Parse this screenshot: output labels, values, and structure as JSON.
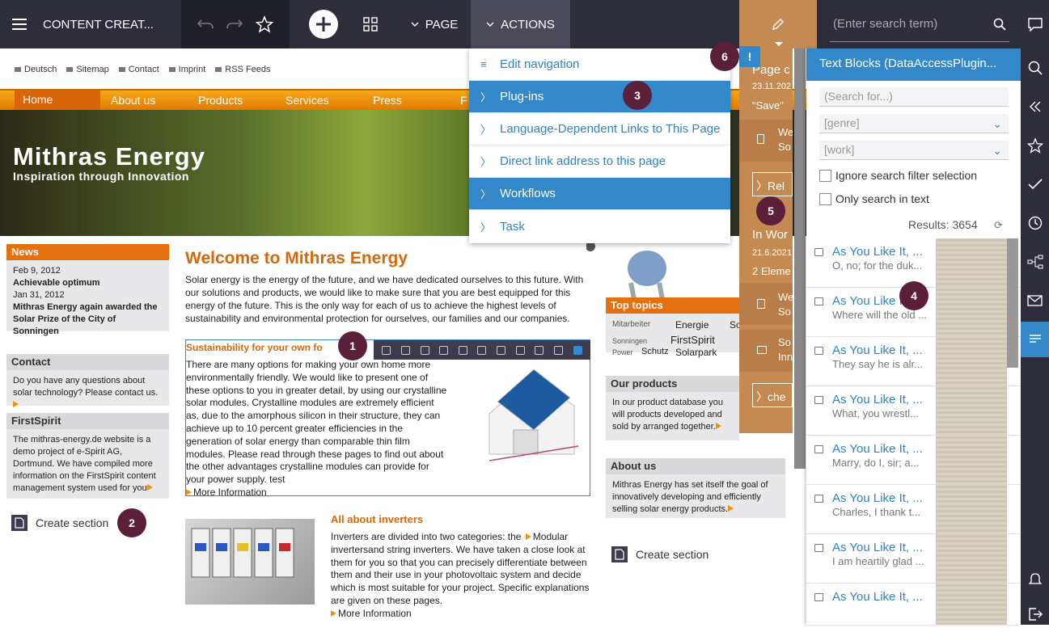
{
  "topbar": {
    "app_title": "CONTENT CREAT...",
    "page_menu": "PAGE",
    "actions_menu": "ACTIONS",
    "search_placeholder": "(Enter search term)"
  },
  "website": {
    "utility_links": [
      "Deutsch",
      "Sitemap",
      "Contact",
      "Imprint",
      "RSS Feeds"
    ],
    "nav": [
      "Home",
      "About us",
      "Products",
      "Services",
      "Press",
      "F"
    ],
    "hero_title": "Mithras Energy",
    "hero_subtitle": "Inspiration through Innovation",
    "news": {
      "title": "News",
      "date1": "Feb 9, 2012",
      "headline1": "Achievable optimum",
      "date2": "Jan 31, 2012",
      "headline2": "Mithras Energy again awarded the Solar Prize of the City of Sonningen"
    },
    "contact": {
      "title": "Contact",
      "text": "Do you have any questions about solar technology? Please contact us."
    },
    "firstspirit": {
      "title": "FirstSpirit",
      "text": "The mithras-energy.de website is a demo project of e-Spirit AG, Dortmund. We have compiled more information on the FirstSpirit content management system used for you"
    },
    "create_section_left": "Create section",
    "welcome_title": "Welcome to Mithras Energy",
    "welcome_text": "Solar energy is the energy of the future, and we have dedicated ourselves to this future. With our solutions and products, we would like to make sure that you are best equipped for this energy of the future. This is the only way for each of us to achieve the highest levels of sustainability and environmental protection for ourselves, our families and our companies.",
    "sustain_title": "Sustainability for your own fo",
    "sustain_text": "There are many options for making your own home more environmentally friendly. We would like to present one of these options to you in greater detail, by using our crystalline solar modules. Crystalline modules are extremely efficient as, due to the amorphous silicon in their structure, they can achieve up to 10 percent greater efficiencies in the generation of solar energy than comparable thin film modules. Please read through these pages to find out about the other advantages crystalline modules can provide for your power supply. test",
    "sustain_more": "More Information",
    "inverters_title": "All about inverters",
    "inverters_text": "Inverters are divided into two categories: the ",
    "inverters_link": "Modular",
    "inverters_text2": " invertersand string inverters. We have taken a close look at them for you so that you can precisely differentiate between them and their use in your photovoltaic system and decide which is most suitable for your project. Specific explanations are given on these pages.",
    "inverters_more": "More Information",
    "top_topics": {
      "title": "Top topics",
      "tags": [
        "Mitarbeiter",
        "Energie",
        "So",
        "Sonningen",
        "FirstSpirit",
        "Power",
        "Schutz",
        "Solarpark"
      ]
    },
    "our_products": {
      "title": "Our products",
      "text": "In our product database you will products developed and sold by arranged together."
    },
    "about_us": {
      "title": "About us",
      "text": "Mithras Energy has set itself the goal of innovatively developing and efficiently selling solar energy products."
    },
    "create_section_right": "Create section"
  },
  "actions_dropdown": {
    "items": [
      {
        "label": "Edit navigation",
        "selected": false
      },
      {
        "label": "Plug-ins",
        "selected": true
      },
      {
        "label": "Language-Dependent Links to This Page",
        "selected": false
      },
      {
        "label": "Direct link address to this page",
        "selected": false
      },
      {
        "label": "Workflows",
        "selected": true
      },
      {
        "label": "Task",
        "selected": false
      }
    ]
  },
  "workflow_panel": {
    "title": "Page c",
    "date1": "23.11.202",
    "status": "\"Save\"",
    "item1a": "We",
    "item1b": "So",
    "rel_button": "Rel",
    "in_work": "In Wor",
    "date2": "21.6.2021",
    "elements": "2 Eleme",
    "item2a": "We",
    "item2b": "So",
    "item3a": "So",
    "item3b": "Inn",
    "che_button": "che"
  },
  "text_blocks": {
    "header": "Text Blocks (DataAccessPlugin...",
    "search_placeholder": "(Search for...)",
    "genre_placeholder": "[genre]",
    "work_placeholder": "[work]",
    "ignore_filter": "Ignore search filter selection",
    "only_text": "Only search in text",
    "results_label": "Results: 3654",
    "results": [
      {
        "title": "As You Like It, ...",
        "snippet": "O, no; for the duk..."
      },
      {
        "title": "As You Like It, ...",
        "snippet": "Where will the old ..."
      },
      {
        "title": "As You Like It, ...",
        "snippet": "They say he is alr..."
      },
      {
        "title": "As You Like It, ...",
        "snippet": "What, you wrestl..."
      },
      {
        "title": "As You Like It, ...",
        "snippet": "Marry, do I, sir; a..."
      },
      {
        "title": "As You Like It, ...",
        "snippet": "Charles, I thank t..."
      },
      {
        "title": "As You Like It, ...",
        "snippet": "I am heartily glad ..."
      },
      {
        "title": "As You Like It, ...",
        "snippet": ""
      }
    ]
  },
  "badges": [
    "1",
    "2",
    "3",
    "4",
    "5",
    "6"
  ],
  "colors": {
    "topbar": "#2e2e3a",
    "accent_blue": "#3288c8",
    "orange": "#e5700f",
    "workflow_panel": "#c48a52",
    "badge": "#5b1f3a"
  }
}
